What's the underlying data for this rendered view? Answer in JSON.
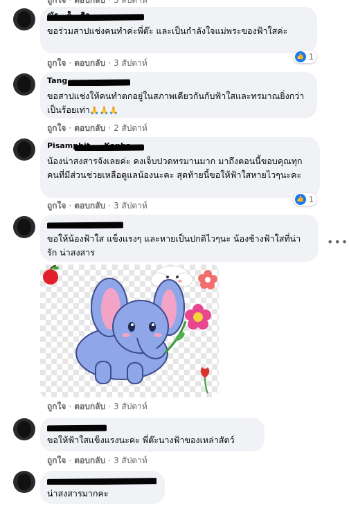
{
  "comments": [
    {
      "name": "ณัฐ...ก็...ติก",
      "text": "ขอร่วมสาปแช่งคนทำค่ะพี่ต๊ะ และเป็นกำลังใจแม่พระของฟ้าใสค่ะ",
      "like": "ถูกใจ",
      "reply": "ตอบกลับ",
      "time": "3 สัปดาห์",
      "reaction_count": "1"
    },
    {
      "name": "Tang ...",
      "text": "ขอสาปแช่งให้คนทำตกอยู่ในสภาพเดียวกันกับฟ้าใสและทรมาณยิ่งกว่าเป็นร้อยเท่า",
      "emoji": "🙏🙏🙏",
      "like": "ถูกใจ",
      "reply": "ตอบกลับ",
      "time": "2 สัปดาห์"
    },
    {
      "name": "Pisamphit ... Kanha...",
      "text": "น้องน่าสงสารจังเลยค่ะ คงเจ็บปวดทรมานมาก มาถึงตอนนี้ขอบคุณทุกคนที่มีส่วนช่วยเหลือดูแลน้องนะคะ สุดท้ายนี้ขอให้ฟ้าใสหายไวๆนะคะ",
      "like": "ถูกใจ",
      "reply": "ตอบกลับ",
      "time": "3 สัปดาห์",
      "reaction_count": "1"
    },
    {
      "name": "...",
      "text": "ขอให้น้องฟ้าใส แข็งแรงๆ และหายเป็นปกติไวๆนะ น้องช้างฟ้าใสที่น่ารัก น่าสงสาร",
      "like": "ถูกใจ",
      "reply": "ตอบกลับ",
      "time": "3 สัปดาห์"
    },
    {
      "name": "...",
      "text": "ขอให้ฟ้าใสแข็งแรงนะคะ พี่ต๊ะนางฟ้าของเหล่าสัตว์",
      "like": "ถูกใจ",
      "reply": "ตอบกลับ",
      "time": "3 สัปดาห์"
    },
    {
      "name": "...",
      "text": "น่าสงสารมากคะ"
    }
  ],
  "top_partial": {
    "like": "ถูกใจ",
    "reply": "ตอบกลับ",
    "time": "3 สัปดาห์"
  },
  "more_options": "•••",
  "icons": {
    "like": "thumbs-up-icon",
    "more": "more-options-icon",
    "sticker": "elephant-sticker"
  },
  "colors": {
    "bubble": "#f0f2f5",
    "meta": "#65676b",
    "like_blue": "#1877f2"
  }
}
